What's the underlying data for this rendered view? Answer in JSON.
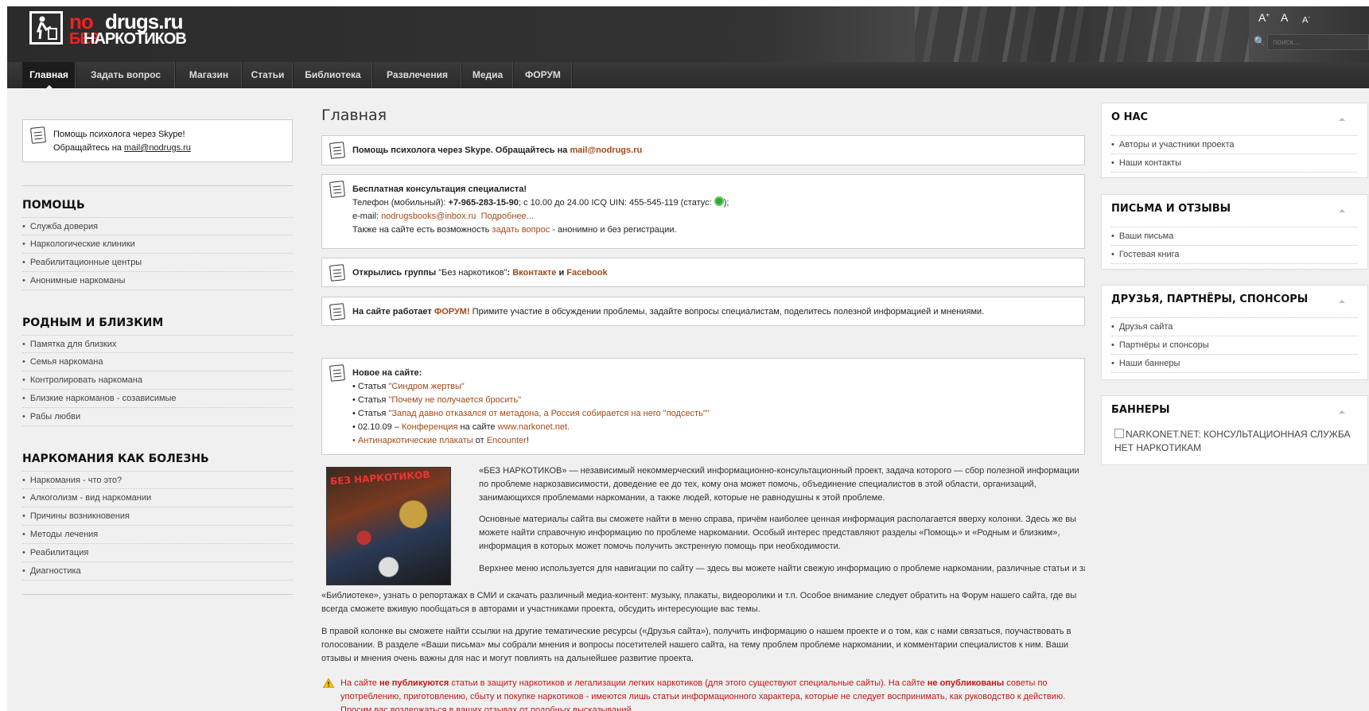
{
  "header": {
    "logo_top_red": "no",
    "logo_top_white": "drugs.ru",
    "logo_bottom_red": "БЕЗ",
    "logo_bottom_white": "НАРКОТИКОВ",
    "font_size_labels": [
      "A",
      "A",
      "A"
    ],
    "search_placeholder": "поиск..."
  },
  "nav": {
    "items": [
      "Главная",
      "Задать вопрос",
      "Магазин",
      "Статьи",
      "Библиотека",
      "Развлечения",
      "Медиа",
      "ФОРУМ"
    ],
    "active": "Главная"
  },
  "left": {
    "skype_line1": "Помощь психолога через Skype!",
    "skype_line2_prefix": "Обращайтесь на ",
    "skype_email": "mail@nodrugs.ru",
    "sections": [
      {
        "title": "ПОМОЩЬ",
        "items": [
          "Служба доверия",
          "Наркологические клиники",
          "Реабилитационные центры",
          "Анонимные наркоманы"
        ]
      },
      {
        "title": "РОДНЫМ И БЛИЗКИМ",
        "items": [
          "Памятка для близких",
          "Семья наркомана",
          "Контролировать наркомана",
          "Близкие наркоманов - созависимые",
          "Рабы любви"
        ]
      },
      {
        "title": "НАРКОМАНИЯ КАК БОЛЕЗНЬ",
        "items": [
          "Наркомания - что это?",
          "Алкоголизм - вид наркомании",
          "Причины возникновения",
          "Методы лечения",
          "Реабилитация",
          "Диагностика"
        ]
      }
    ]
  },
  "main": {
    "title": "Главная",
    "box1": {
      "text": "Помощь психолога через Skype. Обращайтесь на ",
      "email": "mail@nodrugs.ru"
    },
    "box2": {
      "heading": "Бесплатная консультация специалиста!",
      "phone_prefix": "Телефон (мобильный): ",
      "phone": "+7-965-283-15-90",
      "phone_suffix": "; с 10.00 до 24.00 ICQ UIN: 455-545-119 (статус: ",
      "phone_end": ");",
      "email_label": "e-mail: ",
      "email": "nodrugsbooks@inbox.ru",
      "more": "Подробнее...",
      "also_prefix": "Также на сайте есть возможность ",
      "also_link": "задать вопрос",
      "also_suffix": " - анонимно и без регистрации."
    },
    "box3": {
      "prefix": "Открылись группы ",
      "quoted": "\"Без наркотиков\"",
      "colon": ": ",
      "vk": "Вконтакте",
      "and": " и ",
      "fb": "Facebook"
    },
    "box4": {
      "prefix": "На сайте работает ",
      "forum": "ФОРУМ!",
      "suffix": " Примите участие в обсуждении проблемы, задайте вопросы специалистам, поделитесь полезной информацией и мнениями."
    },
    "news": {
      "heading": "Новое на сайте:",
      "item1_prefix": "• Статья ",
      "item1_link": "\"Синдром жертвы\"",
      "item2_prefix": "• Статья ",
      "item2_link": "\"Почему не получается бросить\"",
      "item3_prefix": "• Статья ",
      "item3_link": "\"Запад давно отказался от метадона, а Россия собирается на него \"подсесть\"\"",
      "item4_prefix": "• 02.10.09 – ",
      "item4_link": "Конференция",
      "item4_mid": " на сайте ",
      "item4_site": "www.narkonet.net.",
      "item5_prefix": "• ",
      "item5_link": "Антинаркотические плакаты",
      "item5_mid": " от ",
      "item5_org": "Encounter",
      "item5_end": "!"
    },
    "thumb_label": "БЕЗ НАРКОТИКОВ",
    "para1": "«БЕЗ НАРКОТИКОВ» — независимый некоммерческий информационно-консультационный проект, задача которого — сбор полезной информации по проблеме наркозависимости, доведение ее до тех, кому она может помочь, объединение специалистов в этой области, организаций, занимающихся проблемами наркомании, а также людей, которые не равнодушны к этой проблеме.",
    "para2": "Основные материалы сайта вы сможете найти в меню справа, причём наиболее ценная информация располагается вверху колонки. Здесь же вы можете найти справочную информацию по проблеме наркомании. Особый интерес представляют разделы «Помощь» и «Родным и близким», информация в которых может помочь получить экстренную помощь при необходимости.",
    "para3a": "Верхнее меню используется для навигации по сайту — здесь вы можете найти свежую информацию о проблеме наркомании, различные статьи и заметки известных психологов и наркологов («Статьи» и «Новости»), скачать бесплатно книги о наркотиках и наркомании в",
    "para3b": "«Библиотеке», узнать о репортажах в СМИ и скачать различный медиа-контент: музыку, плакаты, видеоролики и т.п. Особое внимание следует обратить на Форум нашего сайта, где вы всегда сможете вживую пообщаться в авторами и участниками проекта, обсудить интересующие вас темы.",
    "para4": "В правой колонке вы сможете найти ссылки на другие тематические ресурсы («Друзья сайта»), получить информацию о нашем проекте и о том, как с нами связаться, поучаствовать в голосовании. В разделе «Ваши письма» мы собрали мнения и вопросы посетителей нашего сайта, на тему проблем проблеме наркомании, и комментарии специалистов к ним. Ваши отзывы и мнения очень важны для нас и могут повлиять на дальнейшее развитие проекта.",
    "warning": {
      "t1": "На сайте ",
      "b1": "не публикуются",
      "t2": " статьи в защиту наркотиков и легализации легких наркотиков (для этого существуют специальные сайты). На сайте ",
      "b2": "не опубликованы",
      "t3": " советы по употреблению, приготовлению, сбыту и покупке наркотиков - имеются лишь статьи информационного характера, которые не следует воспринимать, как руководство к действию. Просим вас воздержаться в ваших отзывах от подобных высказываний."
    }
  },
  "right": {
    "sections": [
      {
        "title": "О НАС",
        "items": [
          "Авторы и участники проекта",
          "Наши контакты"
        ]
      },
      {
        "title": "ПИСЬМА И ОТЗЫВЫ",
        "items": [
          "Ваши письма",
          "Гостевая книга"
        ]
      },
      {
        "title": "ДРУЗЬЯ, ПАРТНЁРЫ, СПОНСОРЫ",
        "items": [
          "Друзья сайта",
          "Партнёры и спонсоры",
          "Наши баннеры"
        ]
      },
      {
        "title": "БАННЕРЫ",
        "items": []
      }
    ],
    "banner_alt": "NARKONET.NET: КОНСУЛЬТАЦИОННАЯ СЛУЖБА НЕТ НАРКОТИКАМ"
  },
  "colors": {
    "link": "#a24a16",
    "warning": "#c01818",
    "nav_bg": "#2a2a2a",
    "header_bg": "#2b2b2b"
  }
}
